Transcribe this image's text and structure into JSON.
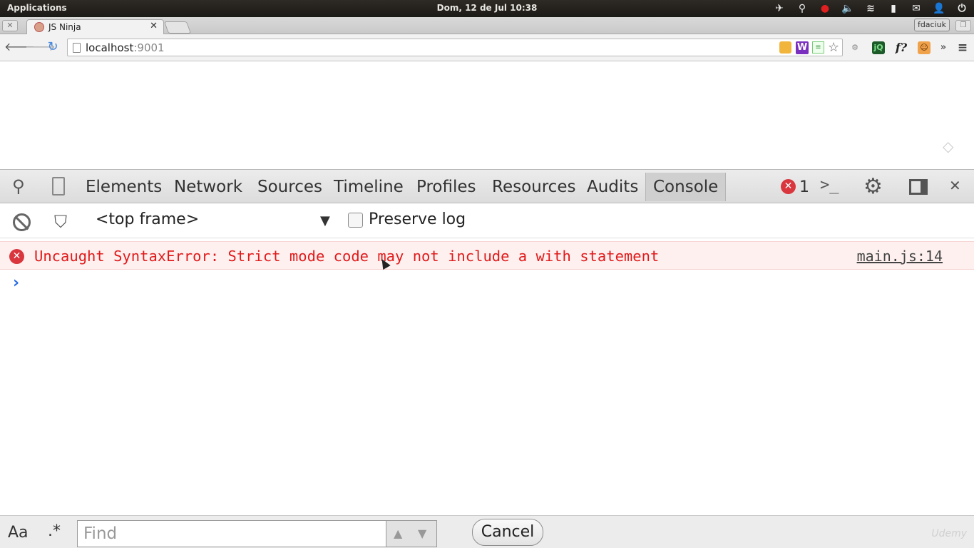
{
  "os": {
    "apps_label": "Applications",
    "clock": "Dom, 12 de Jul 10:38"
  },
  "browser": {
    "tab_title": "JS Ninja",
    "profile_name": "fdaciuk",
    "url_host": "localhost",
    "url_port": ":9001",
    "extensions": [
      "W",
      "jQ",
      "f?"
    ]
  },
  "devtools": {
    "tabs": [
      "Elements",
      "Network",
      "Sources",
      "Timeline",
      "Profiles",
      "Resources",
      "Audits",
      "Console"
    ],
    "active_tab": "Console",
    "error_count": "1",
    "frame_select": "<top frame>",
    "preserve_log_label": "Preserve log",
    "messages": [
      {
        "level": "error",
        "text": "Uncaught SyntaxError: Strict mode code may not include a with statement",
        "source": "main.js:14"
      }
    ],
    "prompt_symbol": "›"
  },
  "findbar": {
    "case_label": "Aa",
    "regex_label": ".*",
    "placeholder": "Find",
    "cancel_label": "Cancel"
  },
  "watermark": "Udemy",
  "colors": {
    "error_red": "#e01a1a",
    "error_bg": "#fff0f0",
    "prompt_blue": "#2a6ee8"
  }
}
